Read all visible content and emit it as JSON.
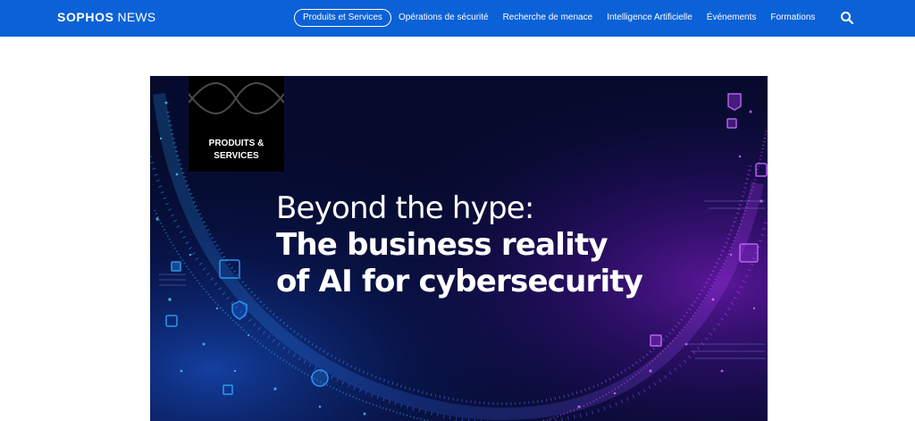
{
  "header": {
    "logo_primary": "SOPHOS",
    "logo_secondary": "NEWS",
    "search_icon": "search-icon",
    "nav": [
      {
        "label": "Produits et Services",
        "active": true
      },
      {
        "label": "Opérations de sécurité",
        "active": false
      },
      {
        "label": "Recherche de menace",
        "active": false
      },
      {
        "label": "Intelligence Artificielle",
        "active": false
      },
      {
        "label": "Événements",
        "active": false
      },
      {
        "label": "Formations",
        "active": false
      }
    ]
  },
  "hero": {
    "tag": "PRODUITS & SERVICES",
    "headline_line1": "Beyond the hype:",
    "headline_line2": "The business reality",
    "headline_line3": "of AI for cybersecurity"
  },
  "colors": {
    "header_bg": "#0b61d6",
    "hero_bg": "#050a2a",
    "accent_blue": "#2fa3ff",
    "accent_purple": "#b23cff"
  }
}
